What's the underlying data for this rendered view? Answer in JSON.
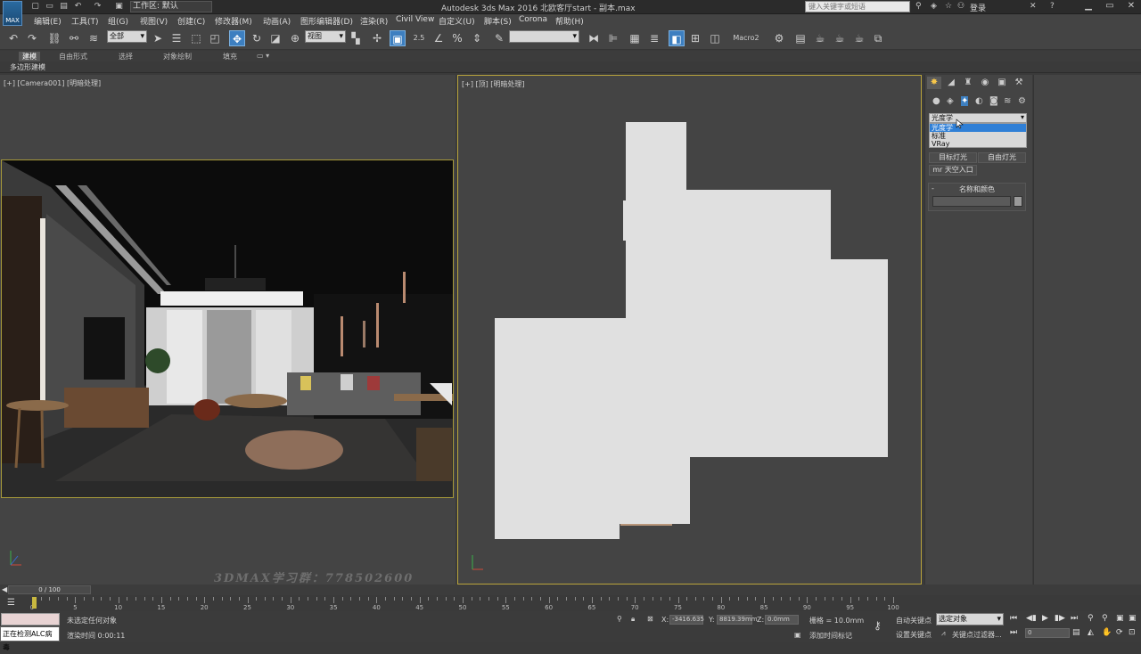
{
  "title_bar": {
    "logo_text": "MAX",
    "workspace_label": "工作区: 默认",
    "app_title": "Autodesk 3ds Max 2016    北欧客厅start - 副本.max",
    "search_placeholder": "键入关键字或短语",
    "login_label": "登录"
  },
  "menu": [
    "编辑(E)",
    "工具(T)",
    "组(G)",
    "视图(V)",
    "创建(C)",
    "修改器(M)",
    "动画(A)",
    "图形编辑器(D)",
    "渲染(R)",
    "Civil View",
    "自定义(U)",
    "脚本(S)",
    "Corona",
    "帮助(H)"
  ],
  "toolbar": {
    "selection_filter": "全部",
    "ref_coord": "视图",
    "named_selection": "",
    "macro_label": "Macro2",
    "snap_label": "2.5"
  },
  "ribbon": {
    "tabs": [
      "建模",
      "自由形式",
      "选择",
      "对象绘制",
      "填充"
    ],
    "active_tab": "建模",
    "subpanel": "多边形建模"
  },
  "viewports": {
    "left_label": "[+] [Camera001] [明暗处理]",
    "right_label": "[+] [顶] [明暗处理]",
    "watermark": "3DMAX学习群：778502600"
  },
  "command_panel": {
    "tabs": [
      "create-tab",
      "modify-tab",
      "hierarchy-tab",
      "motion-tab",
      "display-tab",
      "utilities-tab"
    ],
    "light_type_selected": "光度学",
    "light_type_options": [
      "光度学",
      "标准",
      "VRay"
    ],
    "buttons": [
      "目标灯光",
      "自由灯光",
      "mr 天空入口"
    ],
    "rollout_title": "名称和颜色",
    "rollout_toggle": "-"
  },
  "timeline": {
    "frame_display": "0 / 100",
    "ticks": [
      0,
      5,
      10,
      15,
      20,
      25,
      30,
      35,
      40,
      45,
      50,
      55,
      60,
      65,
      70,
      75,
      80,
      85,
      90,
      95,
      100
    ]
  },
  "status_bar": {
    "selection_status": "未选定任何对象",
    "render_time": "渲染时间  0:00:11",
    "detect_status": "正在检测ALC病毒",
    "x_label": "X:",
    "x_value": "-3416.635",
    "y_label": "Y:",
    "y_value": "8819.39mm",
    "z_label": "Z:",
    "z_value": "0.0mm",
    "grid_label": "栅格 = 10.0mm",
    "add_time_tag": "添加时间标记",
    "auto_key": "自动关键点",
    "set_key": "设置关键点",
    "key_filter_combo": "选定对象",
    "key_filters": "关键点过滤器...",
    "frame_field": "0"
  }
}
